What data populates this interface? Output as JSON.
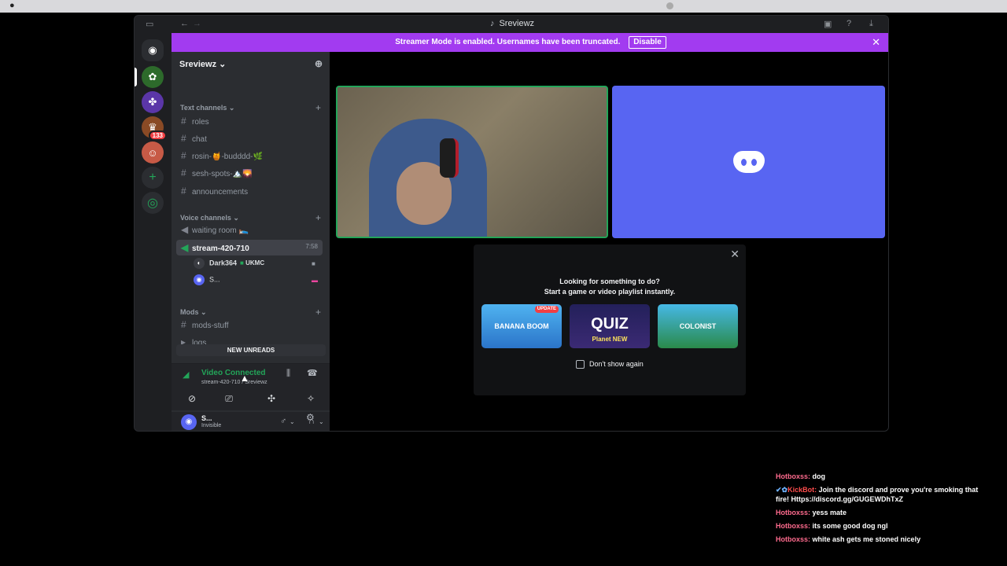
{
  "window": {
    "title": "Sreviewz",
    "back": "←",
    "forward": "→"
  },
  "banner": {
    "text": "Streamer Mode is enabled. Usernames have been truncated.",
    "disable_label": "Disable",
    "close": "✕"
  },
  "servers": [
    {
      "name": "Direct Messages",
      "glyph": "◉"
    },
    {
      "name": "server-green",
      "glyph": "✿"
    },
    {
      "name": "server-leaf",
      "glyph": "✤"
    },
    {
      "name": "server-orange",
      "glyph": "♛",
      "badge": "133"
    },
    {
      "name": "server-face",
      "glyph": "☺"
    },
    {
      "name": "add-server",
      "glyph": "+"
    },
    {
      "name": "explore",
      "glyph": "◎"
    }
  ],
  "guild": {
    "name": "Sreviewz",
    "chevron": "⌄",
    "invite_icon": "👤"
  },
  "categories": {
    "text": "Text channels",
    "voice": "Voice channels",
    "mods": "Mods"
  },
  "text_channels": [
    "roles",
    "chat",
    "rosin-🍯-budddd-🌿",
    "sesh-spots-🏔️🌄",
    "announcements"
  ],
  "voice_channels": {
    "waiting": "waiting room 🛌",
    "stream": "stream-420-710",
    "stream_timer": "7:58"
  },
  "voice_users": [
    {
      "name": "Dark364",
      "tag": "UKMC"
    },
    {
      "name": "S...",
      "tag": ""
    }
  ],
  "mods_channels": [
    "mods-stuff",
    "logs"
  ],
  "new_unreads": "NEW UNREADS",
  "rtc": {
    "status": "Video Connected",
    "sub": "stream-420-710 / Sreviewz"
  },
  "user": {
    "name": "S...",
    "status": "Invisible"
  },
  "activity": {
    "line1": "Looking for something to do?",
    "line2": "Start a game or video playlist instantly.",
    "games": [
      {
        "name": "BANANA BOOM",
        "tag": "UPDATE"
      },
      {
        "name": "QUIZ",
        "sub": "Planet NEW"
      },
      {
        "name": "COLONIST"
      }
    ],
    "dont_show": "Don't show again"
  },
  "chat": [
    {
      "user": "Hotboxss:",
      "text": "dog"
    },
    {
      "badges": "✔✿",
      "user": "KickBot:",
      "text": "Join the discord and prove you're smoking that fire! Https://discord.gg/GUGEWDhTxZ",
      "bot": true
    },
    {
      "user": "Hotboxss:",
      "text": "yess mate"
    },
    {
      "user": "Hotboxss:",
      "text": "its some good dog ngl"
    },
    {
      "user": "Hotboxss:",
      "text": "white ash gets me stoned nicely"
    }
  ]
}
